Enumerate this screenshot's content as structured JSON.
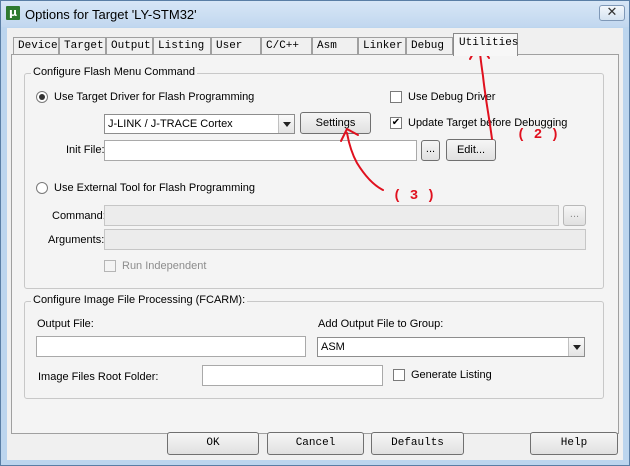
{
  "window": {
    "title": "Options for Target 'LY-STM32'",
    "app_icon": "µ",
    "close_glyph": "✕"
  },
  "tabs": [
    {
      "label": "Device"
    },
    {
      "label": "Target"
    },
    {
      "label": "Output"
    },
    {
      "label": "Listing"
    },
    {
      "label": "User"
    },
    {
      "label": "C/C++"
    },
    {
      "label": "Asm"
    },
    {
      "label": "Linker"
    },
    {
      "label": "Debug"
    },
    {
      "label": "Utilities"
    }
  ],
  "active_tab": "Utilities",
  "flash_group": {
    "title": "Configure Flash Menu Command",
    "use_target_driver_label": "Use Target Driver for Flash Programming",
    "use_target_driver_selected": true,
    "driver_value": "J-LINK / J-TRACE Cortex",
    "settings_label": "Settings",
    "use_debug_driver_label": "Use Debug Driver",
    "use_debug_driver_checked": false,
    "update_target_label": "Update Target before Debugging",
    "update_target_checked": true,
    "update_target_check_glyph": "✔",
    "init_file_label": "Init File:",
    "init_file_value": "",
    "browse_label": "...",
    "edit_label": "Edit...",
    "use_external_tool_label": "Use External Tool for Flash Programming",
    "use_external_tool_selected": false,
    "command_label": "Command:",
    "command_value": "",
    "arguments_label": "Arguments:",
    "arguments_value": "",
    "command_browse_label": "...",
    "run_independent_label": "Run Independent",
    "run_independent_checked": false
  },
  "image_group": {
    "title": "Configure Image File Processing (FCARM):",
    "output_file_label": "Output File:",
    "output_file_value": "",
    "add_output_label": "Add Output File  to Group:",
    "group_value": "ASM",
    "root_folder_label": "Image Files Root Folder:",
    "root_folder_value": "",
    "generate_listing_label": "Generate Listing",
    "generate_listing_checked": false
  },
  "buttons": {
    "ok": "OK",
    "cancel": "Cancel",
    "defaults": "Defaults",
    "help": "Help"
  },
  "annotations": {
    "step2": "( 2 )",
    "step3": "( 3 )",
    "color": "#e0101e"
  }
}
